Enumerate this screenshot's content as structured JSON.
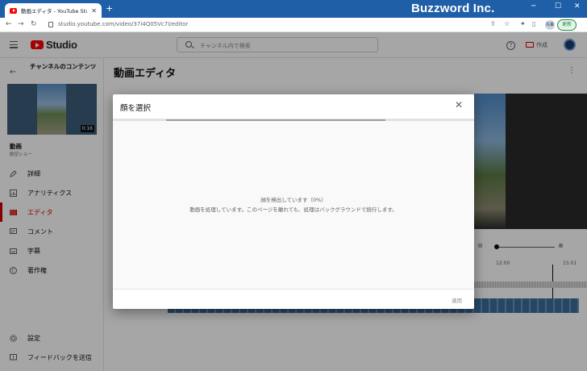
{
  "browser": {
    "tab_title": "動画エディタ - YouTube Studio",
    "brand": "Buzzword Inc.",
    "url": "studio.youtube.com/video/37i4Q05Vc7I/editor",
    "profile_label": "先輩",
    "update_label": "更新"
  },
  "header": {
    "logo_text": "Studio",
    "search_placeholder": "チャンネル内で検索",
    "create_label": "作成"
  },
  "sidebar": {
    "channel_title": "チャンネルのコンテンツ",
    "video_duration": "0:16",
    "video_label": "動画",
    "video_sub": "航空ショー",
    "items": [
      {
        "label": "詳細",
        "icon": "pencil-icon",
        "active": false
      },
      {
        "label": "アナリティクス",
        "icon": "analytics-icon",
        "active": false
      },
      {
        "label": "エディタ",
        "icon": "film-icon",
        "active": true
      },
      {
        "label": "コメント",
        "icon": "comment-icon",
        "active": false
      },
      {
        "label": "字幕",
        "icon": "subtitles-icon",
        "active": false
      },
      {
        "label": "著作権",
        "icon": "copyright-icon",
        "active": false
      }
    ],
    "bottom_items": [
      {
        "label": "設定",
        "icon": "gear-icon"
      },
      {
        "label": "フィードバックを送信",
        "icon": "feedback-icon"
      }
    ]
  },
  "main": {
    "title": "動画エディタ",
    "timeline": {
      "tick_1": "12:00",
      "tick_2": "15:01"
    }
  },
  "dialog": {
    "title": "顔を選択",
    "progress": 0.61,
    "message_1": "顔を検出しています（0%）",
    "message_2": "動画を処理しています。このページを離れても、処理はバックグラウンドで続行します。",
    "apply_label": "適用"
  },
  "colors": {
    "chrome_blue": "#1f5fa8",
    "accent_red": "#cc0000"
  }
}
